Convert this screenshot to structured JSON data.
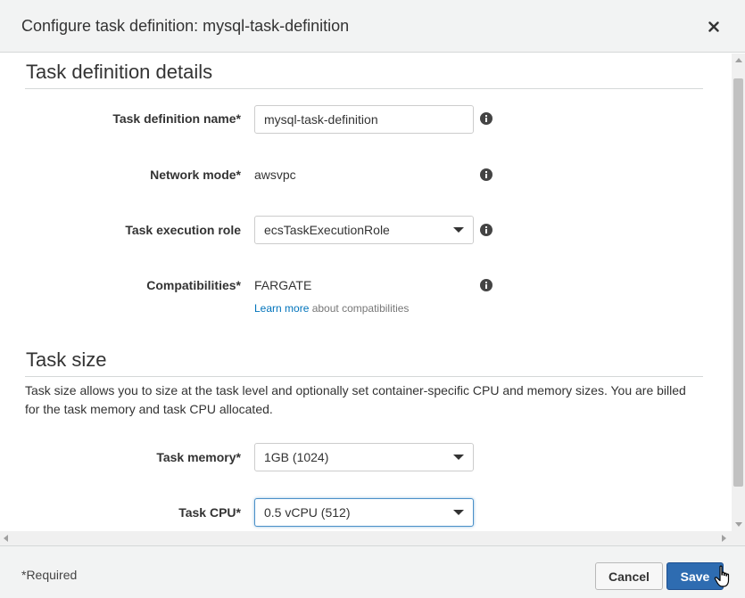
{
  "modal": {
    "title": "Configure task definition: mysql-task-definition"
  },
  "details": {
    "section_title": "Task definition details",
    "name_label": "Task definition name*",
    "name_value": "mysql-task-definition",
    "network_label": "Network mode*",
    "network_value": "awsvpc",
    "role_label": "Task execution role",
    "role_value": "ecsTaskExecutionRole",
    "compat_label": "Compatibilities*",
    "compat_value": "FARGATE",
    "learn_more": "Learn more",
    "learn_more_suffix": " about compatibilities"
  },
  "task_size": {
    "section_title": "Task size",
    "description": "Task size allows you to size at the task level and optionally set container-specific CPU and memory sizes. You are billed for the task memory and task CPU allocated.",
    "memory_label": "Task memory*",
    "memory_value": "1GB (1024)",
    "cpu_label": "Task CPU*",
    "cpu_value": "0.5 vCPU (512)"
  },
  "footer": {
    "required_note": "*Required",
    "cancel_label": "Cancel",
    "save_label": "Save"
  },
  "icons": {
    "close": "close-icon",
    "info": "info-icon",
    "caret": "chevron-down-icon",
    "cursor": "hand-pointer-icon"
  },
  "colors": {
    "primary_button": "#2e6cb1",
    "link": "#0073bb",
    "focus_border": "#4a90c8",
    "header_bg": "#f2f3f3"
  }
}
